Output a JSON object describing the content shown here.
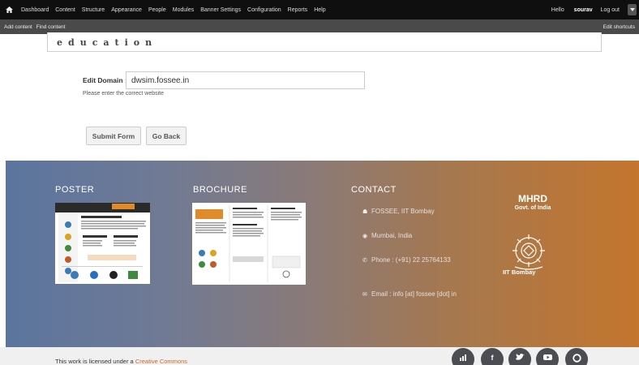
{
  "toolbar": {
    "menu": [
      "Dashboard",
      "Content",
      "Structure",
      "Appearance",
      "People",
      "Modules",
      "Banner Settings",
      "Configuration",
      "Reports",
      "Help"
    ],
    "hello": "Hello",
    "user": "sourav",
    "logout": "Log out"
  },
  "shortcuts": {
    "items": [
      "Add content",
      "Find content"
    ],
    "edit": "Edit shortcuts"
  },
  "header": {
    "brand_word": "education"
  },
  "form": {
    "label": "Edit Domain :",
    "value": "dwsim.fossee.in",
    "help": "Please enter the correct website",
    "submit": "Submit Form",
    "back": "Go Back"
  },
  "footer": {
    "poster_title": "POSTER",
    "brochure_title": "BROCHURE",
    "contact_title": "CONTACT",
    "contact": {
      "org": "FOSSEE, IIT Bombay",
      "city": "Mumbai, India",
      "phone": "Phone : (+91) 22 25764133",
      "email": "Email : info [at] fossee [dot] in"
    },
    "mhrd": "MHRD",
    "govt": "Govt. of India",
    "iit": "IIT Bombay",
    "license_text": "This work is licensed under a",
    "license_link": "Creative Commons",
    "social_icons": [
      "stats-icon",
      "facebook-icon",
      "twitter-icon",
      "youtube-icon",
      "github-icon"
    ]
  },
  "colors": {
    "footer_start": "#5b759e",
    "footer_end": "#c4752d",
    "link": "#c46a2d",
    "social_bg": "#4b4d52"
  }
}
